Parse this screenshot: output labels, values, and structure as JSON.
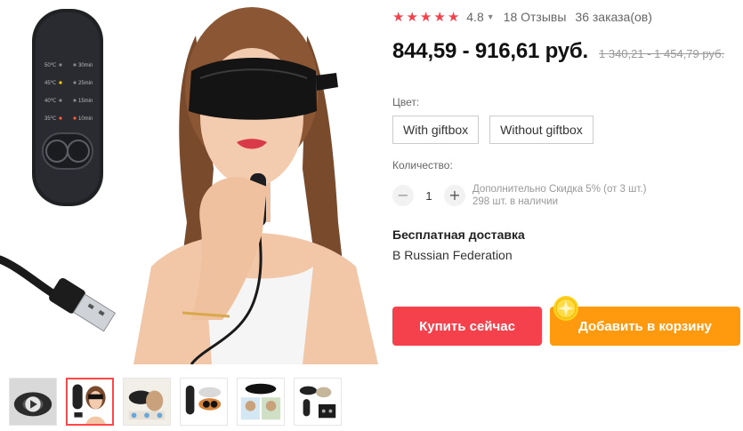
{
  "product": {
    "rating": "4.8",
    "reviews": "18 Отзывы",
    "orders": "36 заказа(ов)",
    "price": "844,59 - 916,61 руб.",
    "old_price": "1 340,21 - 1 454,79 руб."
  },
  "device": {
    "temps": [
      "50℃",
      "45℃",
      "40℃",
      "35℃"
    ],
    "times": [
      "30min",
      "25min",
      "15min",
      "10min"
    ]
  },
  "options": {
    "color_label": "Цвет:",
    "variants": [
      "With giftbox",
      "Without giftbox"
    ]
  },
  "quantity": {
    "label": "Количество:",
    "value": "1",
    "minus_symbol": "−",
    "plus_symbol": "+",
    "note_line1": "Дополнительно Скидка 5% (от 3 шт.)",
    "note_line2": "298 шт. в наличии"
  },
  "shipping": {
    "title": "Бесплатная доставка",
    "destination": "В Russian Federation"
  },
  "actions": {
    "buy_now": "Купить сейчас",
    "add_to_cart": "Добавить в корзину"
  },
  "colors": {
    "star": "#f5414c",
    "buy_button": "#f5414c",
    "cart_button": "#ff9a0e",
    "active_thumb_border": "#ff4747",
    "coin": "#ffd21f"
  },
  "icons": {
    "star": "star-icon",
    "rating_chevron": "chevron-down-icon",
    "cart_badge": "coin-icon",
    "video_play": "play-icon"
  }
}
